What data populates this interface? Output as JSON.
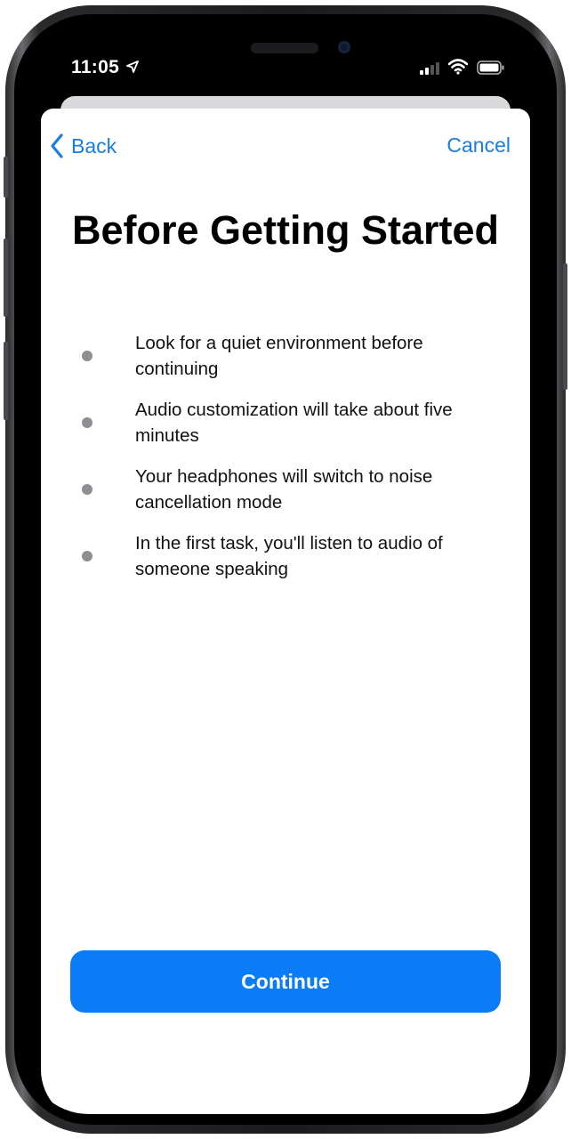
{
  "status_bar": {
    "time": "11:05",
    "icons": [
      "location-arrow-icon",
      "cellular-signal-icon",
      "wifi-icon",
      "battery-icon"
    ]
  },
  "nav": {
    "back_label": "Back",
    "cancel_label": "Cancel"
  },
  "page": {
    "title": "Before Getting Started",
    "bullets": [
      {
        "text": "Look for a quiet environment before continuing"
      },
      {
        "text": "Audio customization will take about five minutes"
      },
      {
        "text": "Your headphones will switch to noise cancellation mode"
      },
      {
        "text": "In the first task, you'll listen to audio of someone speaking"
      }
    ]
  },
  "actions": {
    "continue_label": "Continue"
  },
  "colors": {
    "accent": "#1a7ee0",
    "primary_button": "#0a7cf5",
    "bullet": "#8e8e93"
  }
}
